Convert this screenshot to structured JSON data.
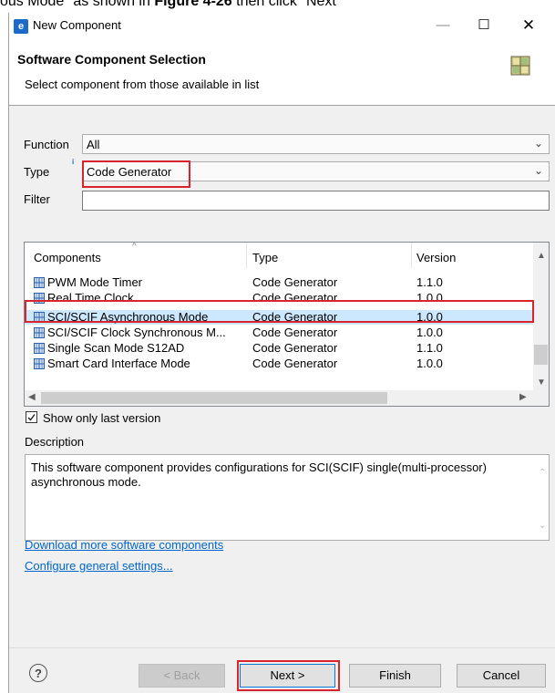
{
  "doc_text": {
    "pre": "ous Mode\" as shown in ",
    "bold": "Figure 4-26",
    "post": " then click \"Next\""
  },
  "window": {
    "title": "New Component",
    "app_icon": "e2-icon",
    "min": "—",
    "max": "☐",
    "close": "✕"
  },
  "header": {
    "title": "Software Component Selection",
    "subtitle": "Select component from those available in list"
  },
  "filters": {
    "function_label": "Function",
    "function_value": "All",
    "type_label": "Type",
    "type_value": "Code Generator",
    "filter_label": "Filter",
    "filter_value": ""
  },
  "table": {
    "columns": [
      "Components",
      "Type",
      "Version"
    ],
    "rows": [
      {
        "name": "PWM Mode Timer",
        "type": "Code Generator",
        "version": "1.1.0"
      },
      {
        "name": "Real Time Clock",
        "type": "Code Generator",
        "version": "1.0.0"
      },
      {
        "name": "SCI/SCIF Asynchronous Mode",
        "type": "Code Generator",
        "version": "1.0.0"
      },
      {
        "name": "SCI/SCIF Clock Synchronous M...",
        "type": "Code Generator",
        "version": "1.0.0"
      },
      {
        "name": "Single Scan Mode S12AD",
        "type": "Code Generator",
        "version": "1.1.0"
      },
      {
        "name": "Smart Card Interface Mode",
        "type": "Code Generator",
        "version": "1.0.0"
      }
    ],
    "selected_index": 2
  },
  "show_only_last": {
    "label": "Show only last version",
    "checked": true
  },
  "description": {
    "label": "Description",
    "text": "This software component provides configurations for SCI(SCIF) single(multi-processor) asynchronous mode."
  },
  "links": {
    "download": "Download more software components",
    "configure": "Configure general settings..."
  },
  "buttons": {
    "help": "?",
    "back": "< Back",
    "next": "Next >",
    "finish": "Finish",
    "cancel": "Cancel"
  },
  "colors": {
    "highlight": "#d9232d",
    "selection": "#cce8ff",
    "link": "#0066cc",
    "icon_blue": "#1b6ac9"
  }
}
